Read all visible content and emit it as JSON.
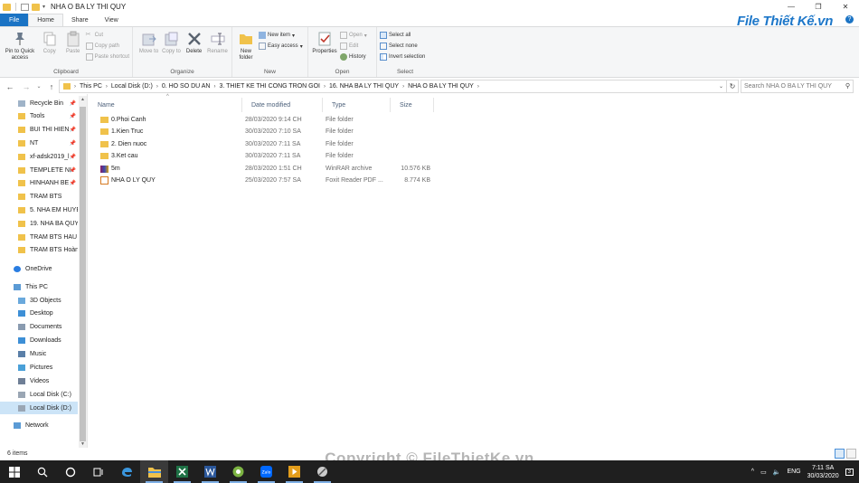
{
  "window": {
    "title": "NHA O BA LY THI QUY",
    "controls": [
      "—",
      "❐",
      "✕"
    ],
    "logo": "File Thiết Kế.vn"
  },
  "ribbon_tabs": [
    "File",
    "Home",
    "Share",
    "View"
  ],
  "ribbon": {
    "clipboard": {
      "label": "Clipboard",
      "pin": "Pin to Quick access",
      "copy": "Copy",
      "paste": "Paste",
      "cut": "Cut",
      "copy_path": "Copy path",
      "paste_shortcut": "Paste shortcut"
    },
    "organize": {
      "label": "Organize",
      "move_to": "Move to",
      "copy_to": "Copy to",
      "delete": "Delete",
      "rename": "Rename"
    },
    "new": {
      "label": "New",
      "new_folder": "New folder",
      "new_item": "New item",
      "easy_access": "Easy access"
    },
    "open": {
      "label": "Open",
      "properties": "Properties",
      "open": "Open",
      "edit": "Edit",
      "history": "History"
    },
    "select": {
      "label": "Select",
      "select_all": "Select all",
      "select_none": "Select none",
      "invert": "Invert selection"
    }
  },
  "address": {
    "crumbs": [
      "This PC",
      "Local Disk (D:)",
      "0. HO SO DU AN",
      "3. THIET KE THI CONG TRON GOI",
      "16. NHA BA LY THI QUY",
      "NHA O BA LY THI QUY"
    ],
    "search_placeholder": "Search NHA O BA LY THI QUY"
  },
  "nav": {
    "quick_access": [
      {
        "label": "Recycle Bin",
        "pinned": true
      },
      {
        "label": "Tools",
        "pinned": true
      },
      {
        "label": "BUI THI HIEN",
        "pinned": true
      },
      {
        "label": "NT",
        "pinned": true
      },
      {
        "label": "xf-adsk2019_l",
        "pinned": true
      },
      {
        "label": "TEMPLETE NI",
        "pinned": true
      },
      {
        "label": "HINHANH BE",
        "pinned": true
      },
      {
        "label": "TRAM BTS",
        "pinned": false
      },
      {
        "label": "5. NHA EM HUYE",
        "pinned": false
      },
      {
        "label": "19. NHA BA QUY",
        "pinned": false
      },
      {
        "label": "TRAM BTS HAU I",
        "pinned": false
      },
      {
        "label": "TRAM BTS Hoàn",
        "pinned": false
      }
    ],
    "onedrive": "OneDrive",
    "this_pc": "This PC",
    "pc_items": [
      "3D Objects",
      "Desktop",
      "Documents",
      "Downloads",
      "Music",
      "Pictures",
      "Videos",
      "Local Disk (C:)",
      "Local Disk (D:)"
    ],
    "network": "Network",
    "pin_glyph": "📌"
  },
  "columns": {
    "name": "Name",
    "date": "Date modified",
    "type": "Type",
    "size": "Size"
  },
  "files": [
    {
      "name": "0.Phoi Canh",
      "date": "28/03/2020 9:14 CH",
      "type": "File folder",
      "size": "",
      "kind": "folder"
    },
    {
      "name": "1.Kien Truc",
      "date": "30/03/2020 7:10 SA",
      "type": "File folder",
      "size": "",
      "kind": "folder"
    },
    {
      "name": "2. Dien nuoc",
      "date": "30/03/2020 7:11 SA",
      "type": "File folder",
      "size": "",
      "kind": "folder"
    },
    {
      "name": "3.Ket cau",
      "date": "30/03/2020 7:11 SA",
      "type": "File folder",
      "size": "",
      "kind": "folder"
    },
    {
      "name": "5m",
      "date": "28/03/2020 1:51 CH",
      "type": "WinRAR archive",
      "size": "10.576 KB",
      "kind": "rar"
    },
    {
      "name": "NHA O LY QUY",
      "date": "25/03/2020 7:57 SA",
      "type": "Foxit Reader PDF ...",
      "size": "8.774 KB",
      "kind": "pdf"
    }
  ],
  "status": {
    "count": "6 items",
    "watermark": "Copyright © FileThietKe.vn"
  },
  "taskbar": {
    "lang": "ENG",
    "time": "7:11 SA",
    "date": "30/03/2020",
    "notif_count": "3"
  },
  "colors": {
    "accent": "#1a73c4",
    "folder": "#f0c24b",
    "selected": "#cce4f7"
  }
}
